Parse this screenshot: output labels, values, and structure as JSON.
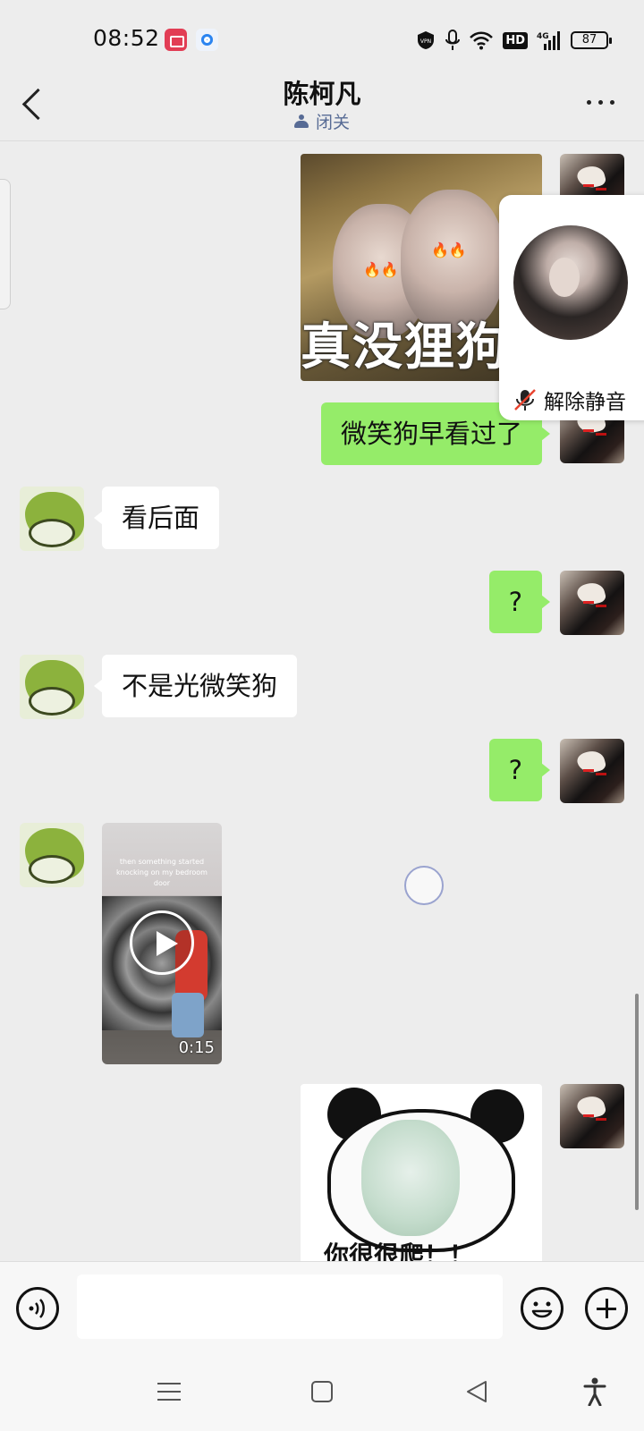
{
  "status_bar": {
    "time": "08:52",
    "hd_label": "HD",
    "network_label": "4G",
    "battery_level": "87",
    "icons": [
      "screen-record-icon",
      "app-notification-icon",
      "vpn-icon",
      "mic-icon",
      "wifi-icon",
      "hd-icon",
      "signal-icon",
      "battery-icon"
    ]
  },
  "header": {
    "title": "陈柯凡",
    "status": "闭关"
  },
  "messages": [
    {
      "side": "right",
      "type": "sticker",
      "caption": "真没狸狗"
    },
    {
      "side": "right",
      "type": "text",
      "text": "微笑狗早看过了"
    },
    {
      "side": "left",
      "type": "text",
      "text": "看后面"
    },
    {
      "side": "right",
      "type": "text",
      "text": "?"
    },
    {
      "side": "left",
      "type": "text",
      "text": "不是光微笑狗"
    },
    {
      "side": "right",
      "type": "text",
      "text": "?"
    },
    {
      "side": "left",
      "type": "video",
      "overlay_text": "then something started knocking on my bedroom door",
      "duration": "0:15"
    },
    {
      "side": "right",
      "type": "sticker",
      "caption": "你很很爬！！"
    }
  ],
  "floating_window": {
    "unmute_label": "解除静音"
  },
  "input_bar": {
    "value": "",
    "placeholder": ""
  },
  "colors": {
    "self_bubble": "#95ec69",
    "other_bubble": "#ffffff",
    "background": "#ededed",
    "status_link": "#576b95"
  }
}
